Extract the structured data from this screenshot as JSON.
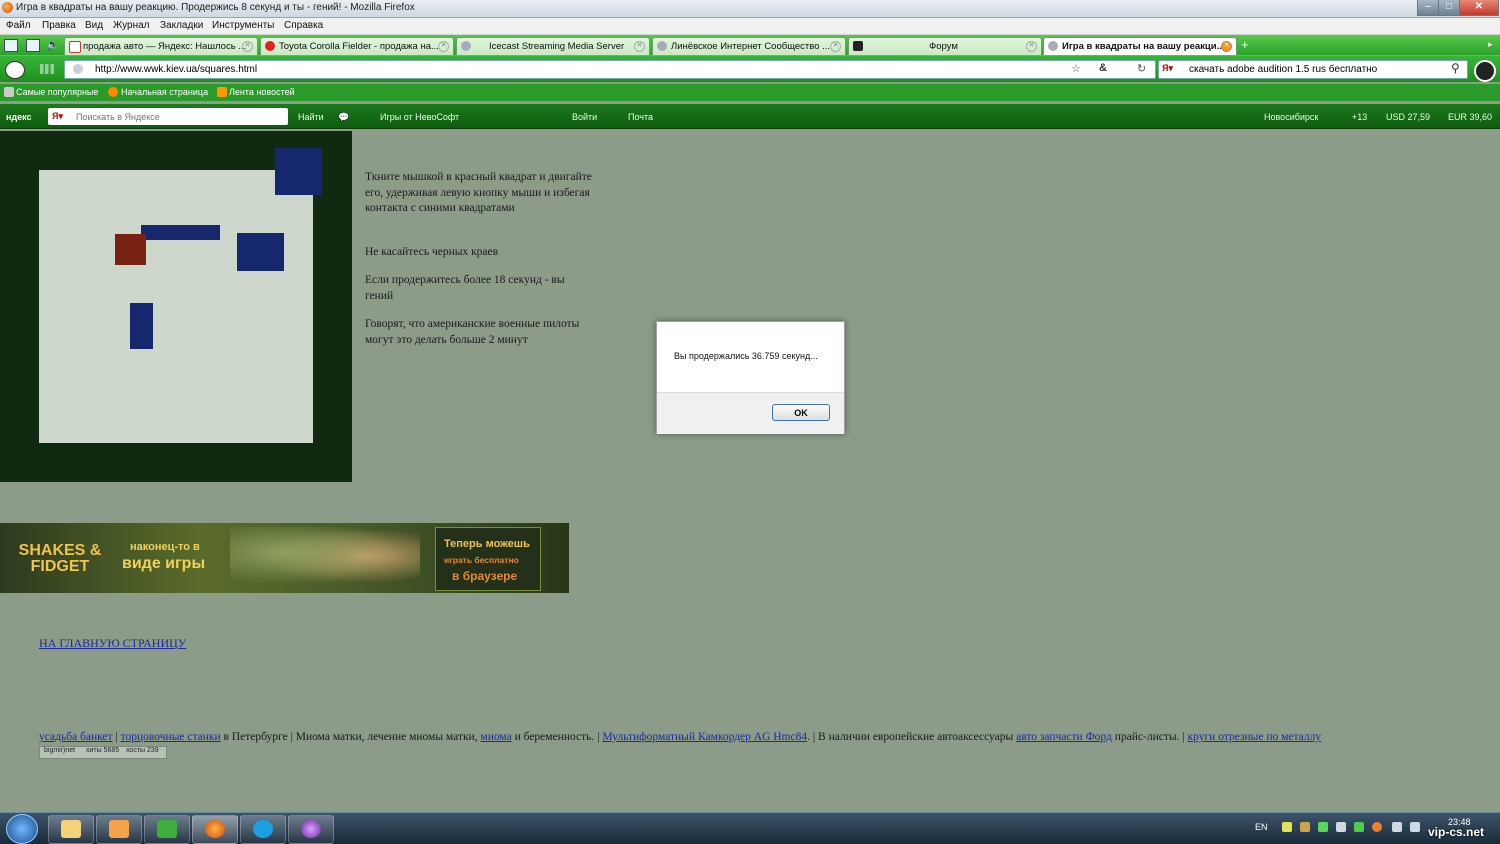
{
  "window": {
    "title": "Игра в квадраты на вашу реакцию. Продержись 8 секунд и ты - гений! - Mozilla Firefox"
  },
  "menu": [
    "Файл",
    "Правка",
    "Вид",
    "Журнал",
    "Закладки",
    "Инструменты",
    "Справка"
  ],
  "tabs": [
    {
      "label": "продажа авто — Яндекс: Нашлось ..."
    },
    {
      "label": "Toyota Corolla Fielder - продажа на..."
    },
    {
      "label": "Icecast Streaming Media Server"
    },
    {
      "label": "Линёвское Интернет Сообщество ..."
    },
    {
      "label": "Форум"
    },
    {
      "label": "Игра в квадраты на вашу реакци..."
    }
  ],
  "nav": {
    "url": "http://www.wwk.kiev.ua/squares.html",
    "search_value": "скачать adobe audition 1.5 rus бесплатно"
  },
  "bookmarks": [
    "Самые популярные",
    "Начальная страница",
    "Лента новостей"
  ],
  "yandexbar": {
    "brand": "ндекс",
    "search_placeholder": "Поискать в Яндексе",
    "find": "Найти",
    "games": "Игры от НевоСофт",
    "login": "Войти",
    "mail": "Почта",
    "city": "Новосибирск",
    "temp": "+13",
    "usd": "USD 27,59",
    "eur": "EUR 39,60"
  },
  "game_text": [
    "Ткните мышкой в красный квадрат и двигайте его, удерживая левую кнопку мыши и избегая контакта с синими квадратами",
    "Не касайтесь черных краев",
    "Если продержитесь более 18 секунд - вы гений",
    "Говорят, что американские военные пилоты могут это делать больше 2 минут"
  ],
  "dialog": {
    "message": "Вы продержались 36.759 секунд...",
    "ok": "OK"
  },
  "banner": {
    "logo": "SHAKES & FIDGET",
    "tagline_1": "наконец-то в",
    "tagline_2": "виде игры",
    "promo_1": "Теперь можешь",
    "promo_2": "играть бесплатно",
    "promo_3": "в браузере"
  },
  "main_link": "НА ГЛАВНУЮ СТРАНИЦУ",
  "footer": {
    "link1": "усадьба банкет",
    "sep1": " | ",
    "link2": "торцовочные станки",
    "text2": " в Петербурге | Миома матки, лечение миомы матки, ",
    "link3": "миома",
    "text3": " и беременность. | ",
    "link4": "Мультиформатный Камкордер AG Hmc84",
    "text4": ". | В наличии европейские автоаксессуары ",
    "link5": "авто запчасти Форд",
    "text5": " прайс-листы. | ",
    "link6": "круги отрезные по металлу"
  },
  "counter": {
    "site": "bigmir)net",
    "hits": "хиты 5685",
    "hosts": "хосты 239"
  },
  "taskbar": {
    "lang": "EN",
    "time": "23:48"
  },
  "watermark": "vip-cs.net",
  "colors": {
    "game_border": "#0f2a10",
    "field": "#cdd7cb",
    "red_square": "#7a2212",
    "blue_square": "#15286e",
    "page_bg": "#8c9c89"
  }
}
